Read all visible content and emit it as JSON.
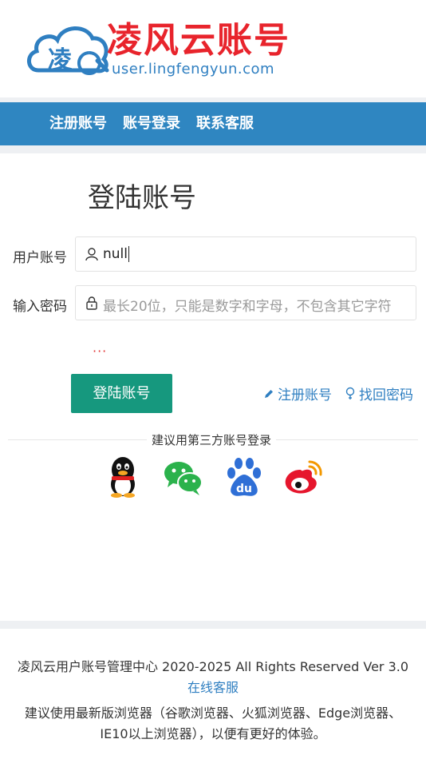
{
  "logo": {
    "title": "凌风云账号",
    "subtitle": "user.lingfengyun.com",
    "cloud_char": "凌",
    "brand_red": "#e8242c",
    "brand_blue": "#2f7fc1"
  },
  "nav": {
    "items": [
      {
        "label": "注册账号"
      },
      {
        "label": "账号登录"
      },
      {
        "label": "联系客服"
      }
    ],
    "color": "#2f86c1"
  },
  "form": {
    "title": "登陆账号",
    "username": {
      "label": "用户账号",
      "value": "null",
      "icon": "user-icon"
    },
    "password": {
      "label": "输入密码",
      "placeholder": "最长20位，只能是数字和字母，不包含其它字符",
      "icon": "lock-icon"
    },
    "error_text": "···",
    "login_button": "登陆账号",
    "register_link": "注册账号",
    "recover_link": "找回密码",
    "button_color": "#16987e"
  },
  "third_party": {
    "label": "建议用第三方账号登录",
    "providers": [
      "qq-icon",
      "wechat-icon",
      "baidu-icon",
      "weibo-icon"
    ]
  },
  "footer": {
    "copyright": "凌风云用户账号管理中心 2020-2025 All Rights Reserved Ver 3.0",
    "service_link": "在线客服",
    "browser_tip_1": "建议使用最新版浏览器（谷歌浏览器、火狐浏览器、Edge浏览器、",
    "browser_tip_2": "IE10以上浏览器），以便有更好的体验。"
  }
}
